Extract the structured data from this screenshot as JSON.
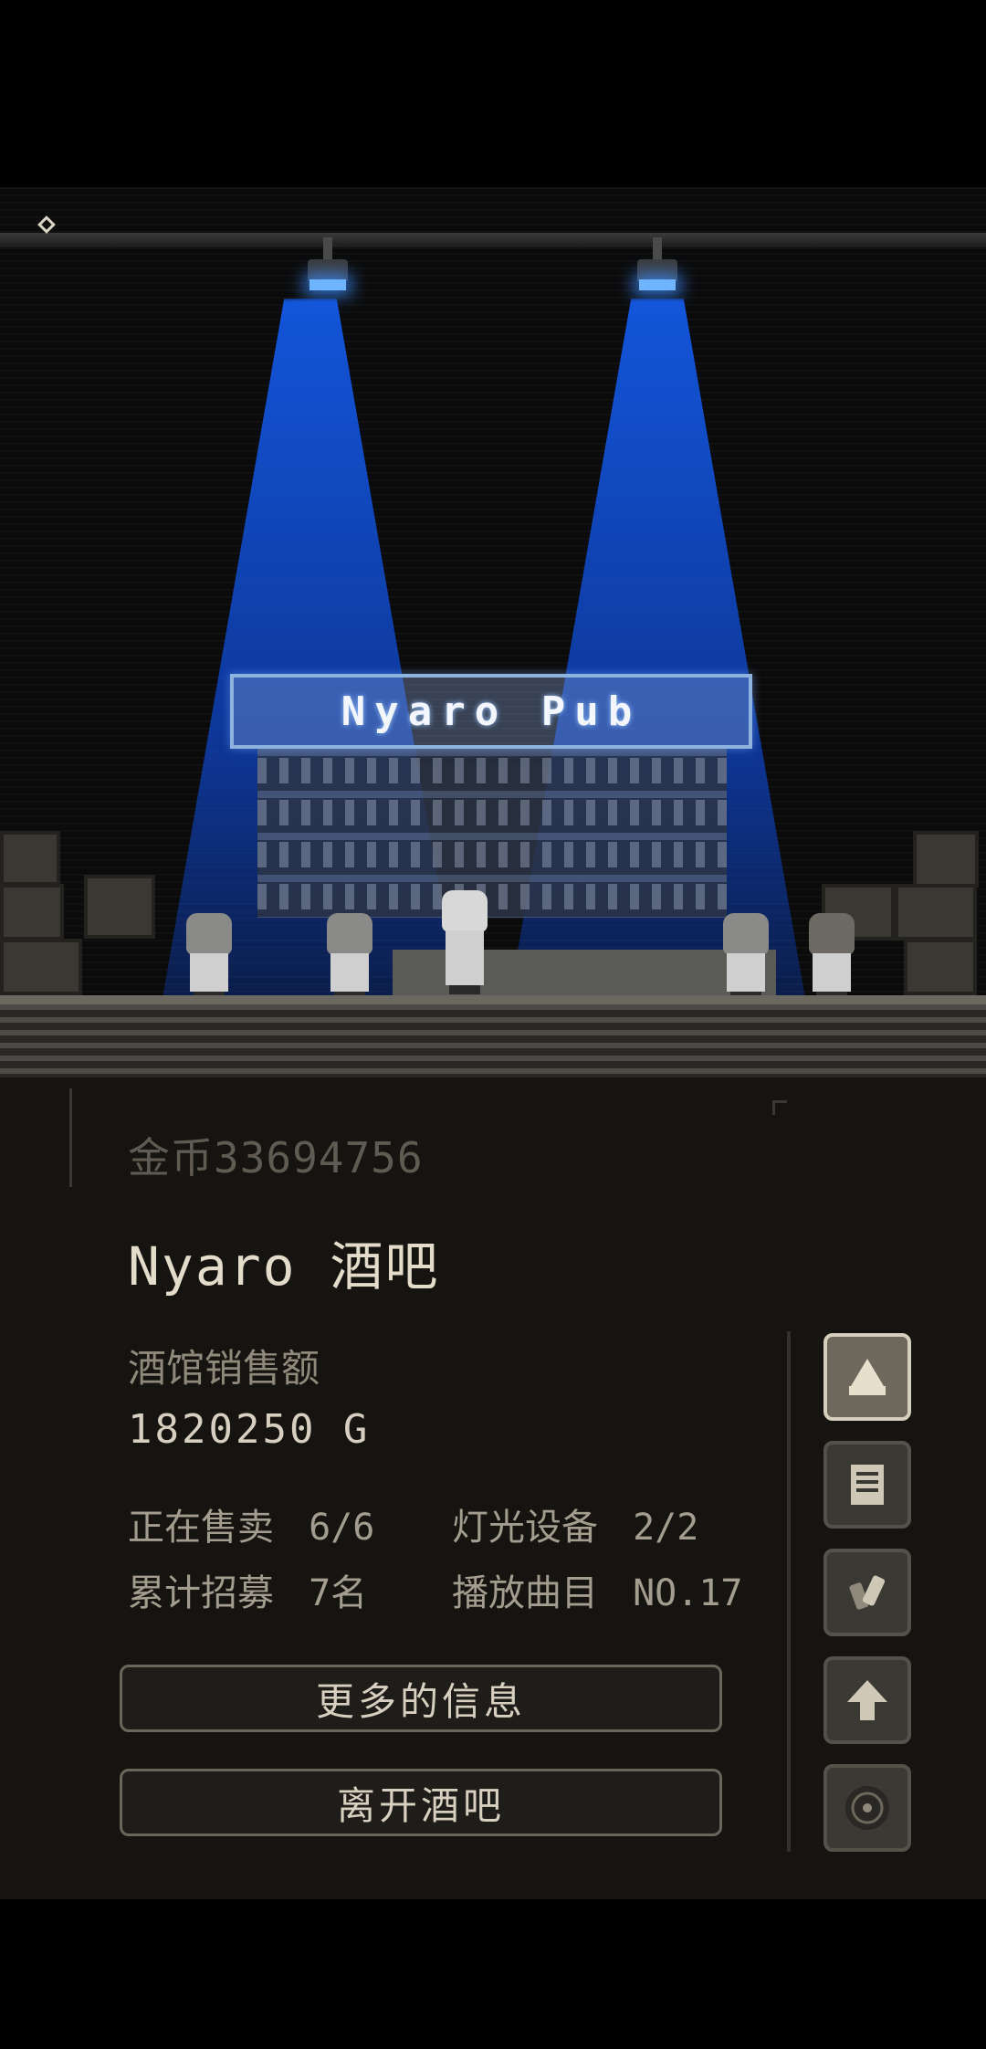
{
  "scene": {
    "sign_text": "Nyaro Pub"
  },
  "panel": {
    "gold_text": "金币33694756",
    "bar_title": "Nyaro 酒吧",
    "sales_label": "酒馆销售额",
    "sales_value": "1820250 G",
    "stats": {
      "selling_label": "正在售卖",
      "selling_value": "6/6",
      "lighting_label": "灯光设备",
      "lighting_value": "2/2",
      "recruit_label": "累计招募",
      "recruit_value": "7名",
      "music_label": "播放曲目",
      "music_value": "NO.17"
    },
    "more_info_button": "更多的信息",
    "leave_button": "离开酒吧"
  },
  "side_buttons": [
    {
      "icon": "bar-counter-icon",
      "active": true
    },
    {
      "icon": "document-icon",
      "active": false
    },
    {
      "icon": "drinks-icon",
      "active": false
    },
    {
      "icon": "upgrade-arrow-icon",
      "active": false
    },
    {
      "icon": "record-disc-icon",
      "active": false
    }
  ],
  "colors": {
    "spotlight": "#1a5fe0",
    "panel_bg": "#161410",
    "text_primary": "#e3dccb",
    "text_muted": "#8f897c"
  }
}
